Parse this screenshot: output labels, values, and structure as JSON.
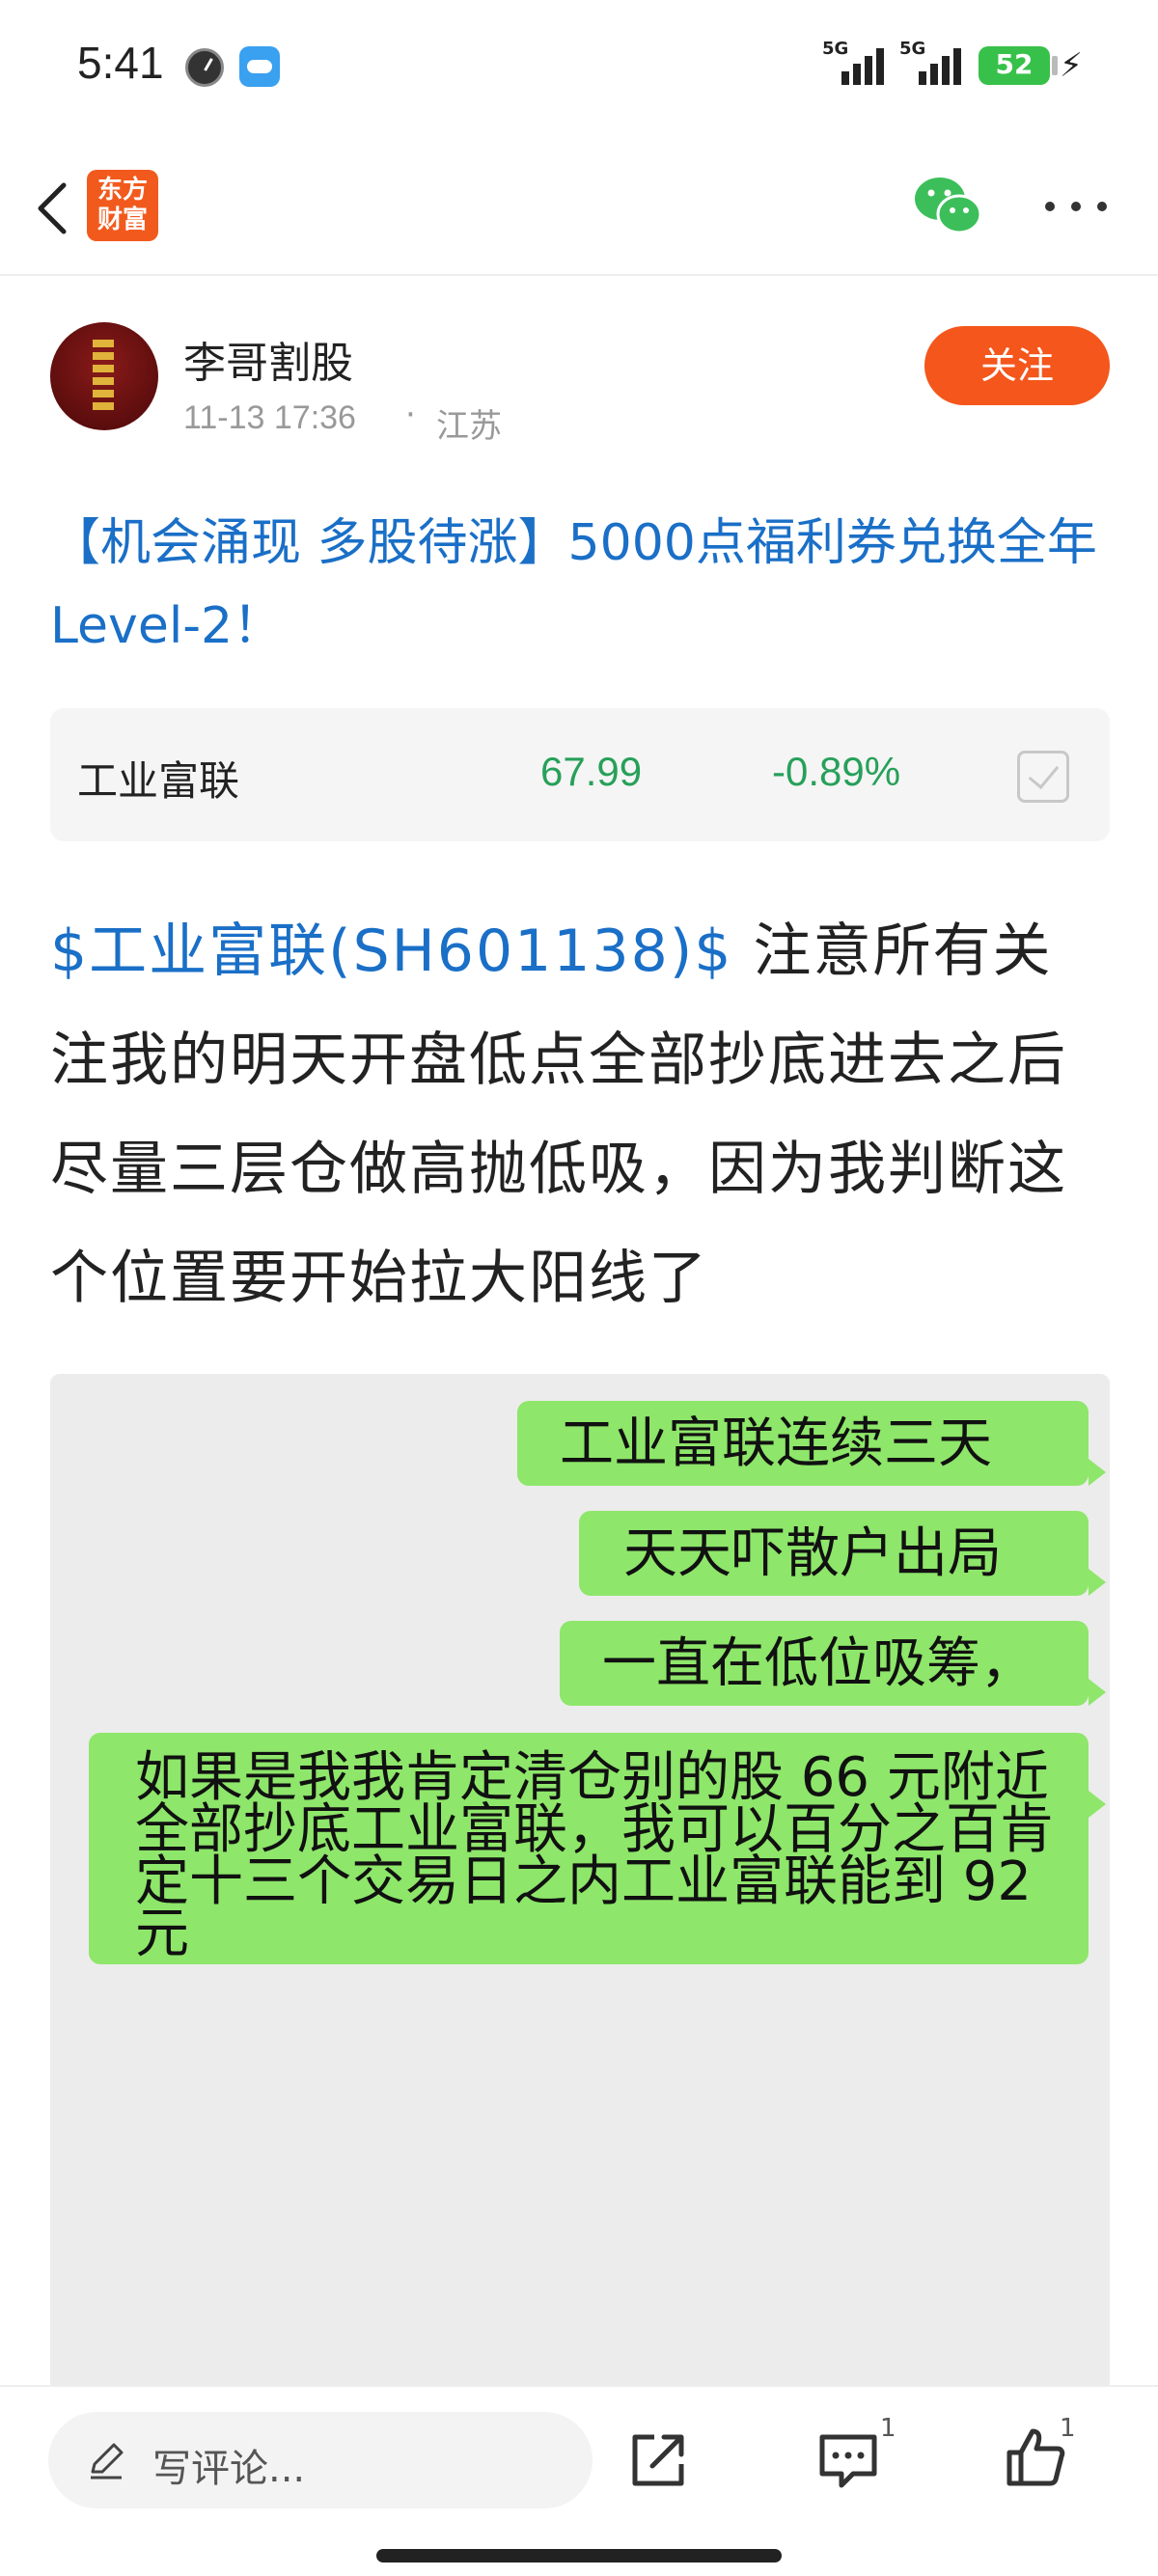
{
  "status_bar": {
    "time": "5:41",
    "network_1": "5G",
    "network_2": "5G",
    "battery": "52"
  },
  "nav": {
    "logo_text_line1": "东方",
    "logo_text_line2": "财富"
  },
  "author": {
    "name": "李哥割股",
    "time": "11-13 17:36",
    "separator": "·",
    "location": "江苏",
    "follow_label": "关注"
  },
  "post": {
    "title": "【机会涌现 多股待涨】5000点福利券兑换全年Level-2！",
    "stock_link": "$工业富联(SH601138)$",
    "body_text": " 注意所有关注我的明天开盘低点全部抄底进去之后尽量三层仓做高抛低吸，因为我判断这个位置要开始拉大阳线了"
  },
  "stock_card": {
    "name": "工业富联",
    "price": "67.99",
    "change": "-0.89%"
  },
  "chat_image": {
    "messages": [
      "工业富联连续三天",
      "天天吓散户出局",
      "一直在低位吸筹，",
      "如果是我我肯定清仓别的股 66 元附近全部抄底工业富联，我可以百分之百肯定十三个交易日之内工业富联能到 92 元"
    ]
  },
  "bottom_bar": {
    "comment_placeholder": "写评论...",
    "comment_count": "1",
    "like_count": "1"
  },
  "colors": {
    "accent_blue": "#1a6fc7",
    "follow_orange": "#f4561c",
    "stock_green": "#27a05a",
    "bubble_green": "#8ee66a"
  }
}
